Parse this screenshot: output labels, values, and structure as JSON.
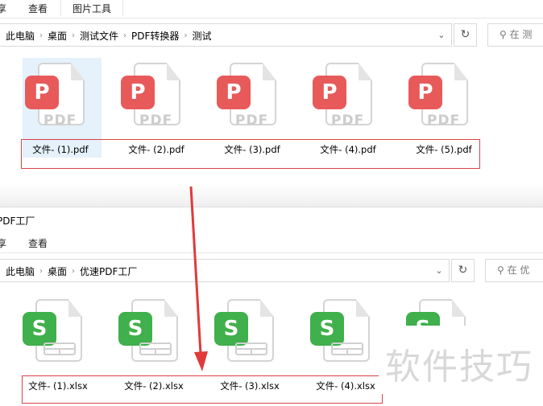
{
  "top_window": {
    "ribbon_tabs": [
      "享",
      "查看",
      "图片工具"
    ],
    "breadcrumb": [
      "此电脑",
      "桌面",
      "测试文件",
      "PDF转换器",
      "测试"
    ],
    "search_placeholder": "在 测",
    "files": [
      {
        "name": "文件- (1).pdf",
        "selected": true
      },
      {
        "name": "文件- (2).pdf"
      },
      {
        "name": "文件- (3).pdf"
      },
      {
        "name": "文件- (4).pdf"
      },
      {
        "name": "文件- (5).pdf"
      }
    ],
    "badge_color": "#e85a5a"
  },
  "bottom_window": {
    "title": "PDF工厂",
    "ribbon_tabs": [
      "享",
      "查看"
    ],
    "breadcrumb": [
      "此电脑",
      "桌面",
      "优速PDF工厂"
    ],
    "search_placeholder": "在 优",
    "files": [
      {
        "name": "文件- (1).xlsx"
      },
      {
        "name": "文件- (2).xlsx"
      },
      {
        "name": "文件- (3).xlsx"
      },
      {
        "name": "文件- (4).xlsx"
      },
      {
        "name": ""
      }
    ],
    "badge_color": "#3fb04b"
  },
  "annotation": {
    "arrow_color": "#e03a3a",
    "box_color": "#d9424a"
  },
  "watermark": "软件技巧"
}
